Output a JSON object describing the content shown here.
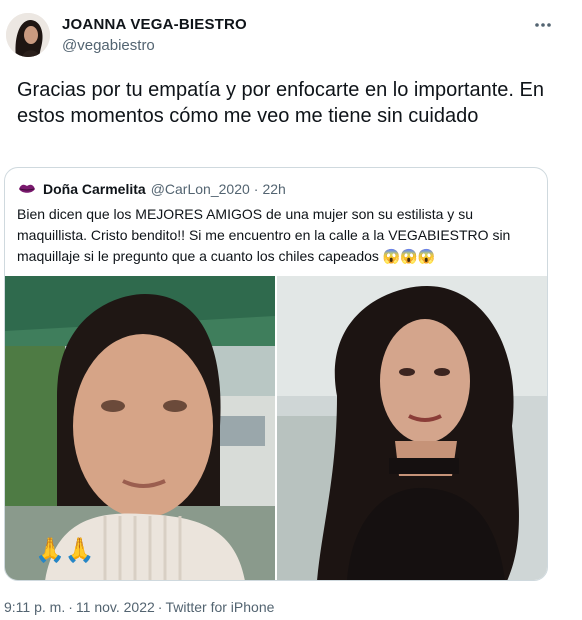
{
  "tweet": {
    "author_name": "JOANNA VEGA-BIESTRO",
    "author_handle": "@vegabiestro",
    "more_icon": "more-icon",
    "text": "Gracias por tu empatía y por enfocarte en lo importante. En estos momentos cómo me veo me tiene sin cuidado"
  },
  "quoted_tweet": {
    "name": "Doña Carmelita",
    "handle": "@CarLon_2020",
    "separator": "·",
    "time": "22h",
    "text": "Bien dicen que los MEJORES AMIGOS de una mujer son su estilista y su maquillista. Cristo bendito!! Si me encuentro en la calle a la VEGABIESTRO sin maquillaje  si le pregunto que a cuanto los chiles capeados ",
    "emoji": [
      "😱",
      "😱",
      "😱"
    ],
    "images": [
      {
        "icon": "photo-no-makeup",
        "overlay_emoji": "🙏🙏"
      },
      {
        "icon": "photo-glam"
      }
    ]
  },
  "footer": {
    "time": "9:11 p. m.",
    "separator": "·",
    "date": "11 nov. 2022",
    "source": "Twitter for iPhone"
  },
  "colors": {
    "text_primary": "#0f1419",
    "text_secondary": "#536471",
    "border": "#cfd9de"
  }
}
